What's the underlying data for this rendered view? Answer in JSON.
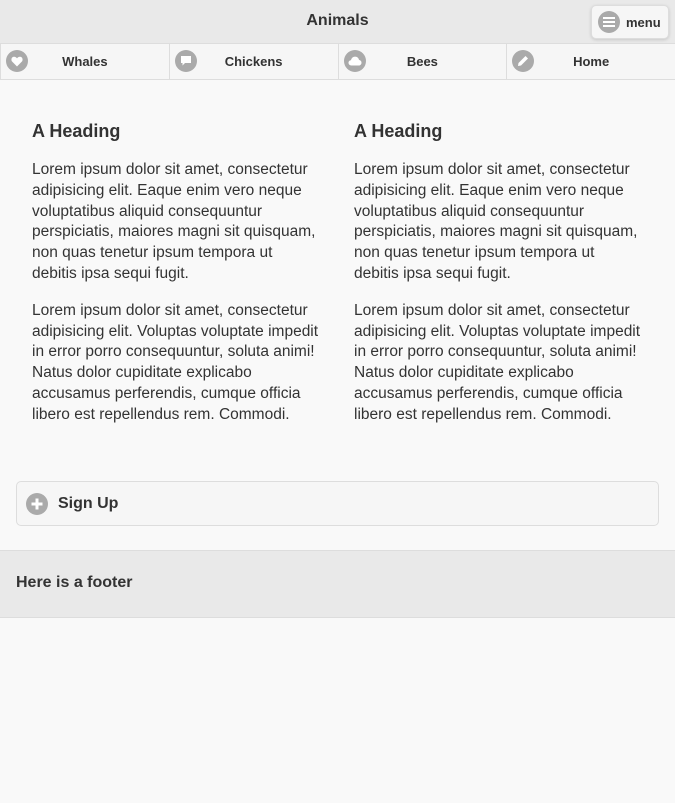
{
  "header": {
    "title": "Animals",
    "menu_label": "menu",
    "menu_icon": "bars-icon"
  },
  "navbar": {
    "items": [
      {
        "label": "Whales",
        "icon": "heart-icon"
      },
      {
        "label": "Chickens",
        "icon": "comment-icon"
      },
      {
        "label": "Bees",
        "icon": "cloud-icon"
      },
      {
        "label": "Home",
        "icon": "edit-icon"
      }
    ]
  },
  "columns": [
    {
      "heading": "A Heading",
      "paragraphs": [
        "Lorem ipsum dolor sit amet, consectetur adipisicing elit. Eaque enim vero neque voluptatibus aliquid consequuntur perspiciatis, maiores magni sit quisquam, non quas tenetur ipsum tempora ut debitis ipsa sequi fugit.",
        "Lorem ipsum dolor sit amet, consectetur adipisicing elit. Voluptas voluptate impedit in error porro consequuntur, soluta animi! Natus dolor cupiditate explicabo accusamus perferendis, cumque officia libero est repellendus rem. Commodi."
      ]
    },
    {
      "heading": "A Heading",
      "paragraphs": [
        "Lorem ipsum dolor sit amet, consectetur adipisicing elit. Eaque enim vero neque voluptatibus aliquid consequuntur perspiciatis, maiores magni sit quisquam, non quas tenetur ipsum tempora ut debitis ipsa sequi fugit.",
        "Lorem ipsum dolor sit amet, consectetur adipisicing elit. Voluptas voluptate impedit in error porro consequuntur, soluta animi! Natus dolor cupiditate explicabo accusamus perferendis, cumque officia libero est repellendus rem. Commodi."
      ]
    }
  ],
  "collapsible": {
    "label": "Sign Up",
    "icon": "plus-icon"
  },
  "footer": {
    "text": "Here is a footer"
  },
  "colors": {
    "background": "#f9f9f9",
    "bar": "#e9e9e9",
    "icon_disc": "#aaaaaa",
    "text": "#333333",
    "border": "#dddddd"
  }
}
